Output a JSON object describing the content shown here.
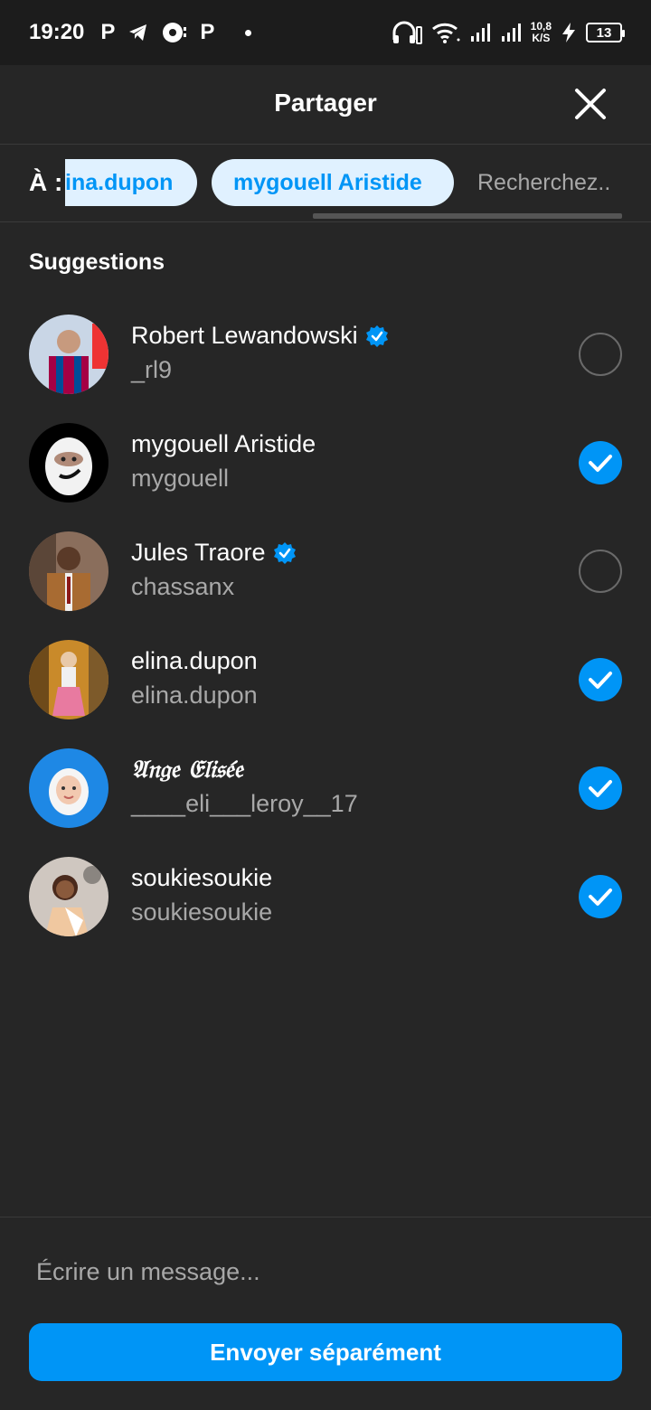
{
  "status_bar": {
    "time": "19:20",
    "left_icons": [
      "p-icon",
      "telegram-icon",
      "circle-app-icon",
      "p-icon",
      "dot-icon"
    ],
    "net_speed_top": "10,8",
    "net_speed_bottom": "K/S",
    "battery": "13"
  },
  "header": {
    "title": "Partager"
  },
  "recipients": {
    "label": "À :",
    "chips": [
      "ina.dupon",
      "mygouell Aristide"
    ],
    "search_placeholder": "Recherchez.."
  },
  "suggestions_title": "Suggestions",
  "suggestions": [
    {
      "name": "Robert Lewandowski",
      "username": "_rl9",
      "verified": true,
      "selected": false
    },
    {
      "name": "mygouell Aristide",
      "username": "mygouell",
      "verified": false,
      "selected": true
    },
    {
      "name": "Jules Traore",
      "username": "chassanx",
      "verified": true,
      "selected": false
    },
    {
      "name": "elina.dupon",
      "username": "elina.dupon",
      "verified": false,
      "selected": true
    },
    {
      "name": "𝔄𝔫𝔤𝔢 𝔈𝔩𝔦𝔰𝔢́𝔢",
      "username": "____eli___leroy__17",
      "verified": false,
      "selected": true
    },
    {
      "name": "soukiesoukie",
      "username": "soukiesoukie",
      "verified": false,
      "selected": true
    }
  ],
  "message": {
    "placeholder": "Écrire un message..."
  },
  "send_button": "Envoyer séparément",
  "colors": {
    "accent": "#0095f6",
    "background": "#262626",
    "chip_bg": "#e0f1ff"
  }
}
